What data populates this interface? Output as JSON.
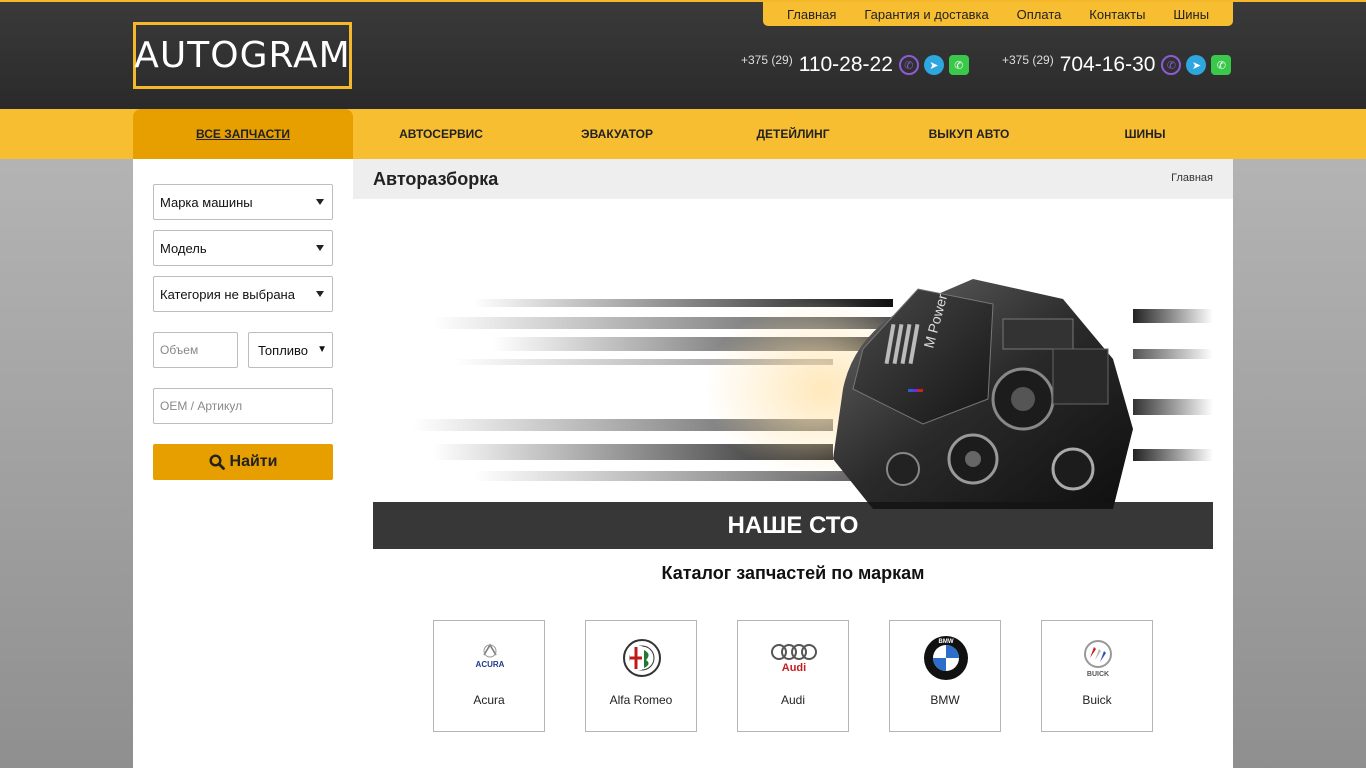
{
  "header": {
    "logo": "AUTOGRAM",
    "top_links": [
      "Главная",
      "Гарантия и доставка",
      "Оплата",
      "Контакты",
      "Шины"
    ],
    "phones": [
      {
        "code": "+375 (29)",
        "number": "110-28-22"
      },
      {
        "code": "+375 (29)",
        "number": "704-16-30"
      }
    ]
  },
  "mainnav": {
    "items": [
      "ВСЕ ЗАПЧАСТИ",
      "АВТОСЕРВИС",
      "ЭВАКУАТОР",
      "ДЕТЕЙЛИНГ",
      "ВЫКУП АВТО",
      "ШИНЫ"
    ],
    "active_index": 0
  },
  "filters": {
    "brand": "Марка машины",
    "model": "Модель",
    "category": "Категория не выбрана",
    "volume_placeholder": "Объем",
    "fuel": "Топливо",
    "oem_placeholder": "OEM / Артикул",
    "search_label": "Найти"
  },
  "page": {
    "title": "Авторазборка",
    "breadcrumb": "Главная"
  },
  "banner": {
    "caption": "НАШЕ СТО",
    "engine_label": "M Power"
  },
  "catalog": {
    "title": "Каталог запчастей по маркам",
    "brands": [
      "Acura",
      "Alfa Romeo",
      "Audi",
      "BMW",
      "Buick"
    ]
  },
  "colors": {
    "accent": "#f7be32",
    "accent_dark": "#e79f00",
    "header_bg": "#333333"
  }
}
